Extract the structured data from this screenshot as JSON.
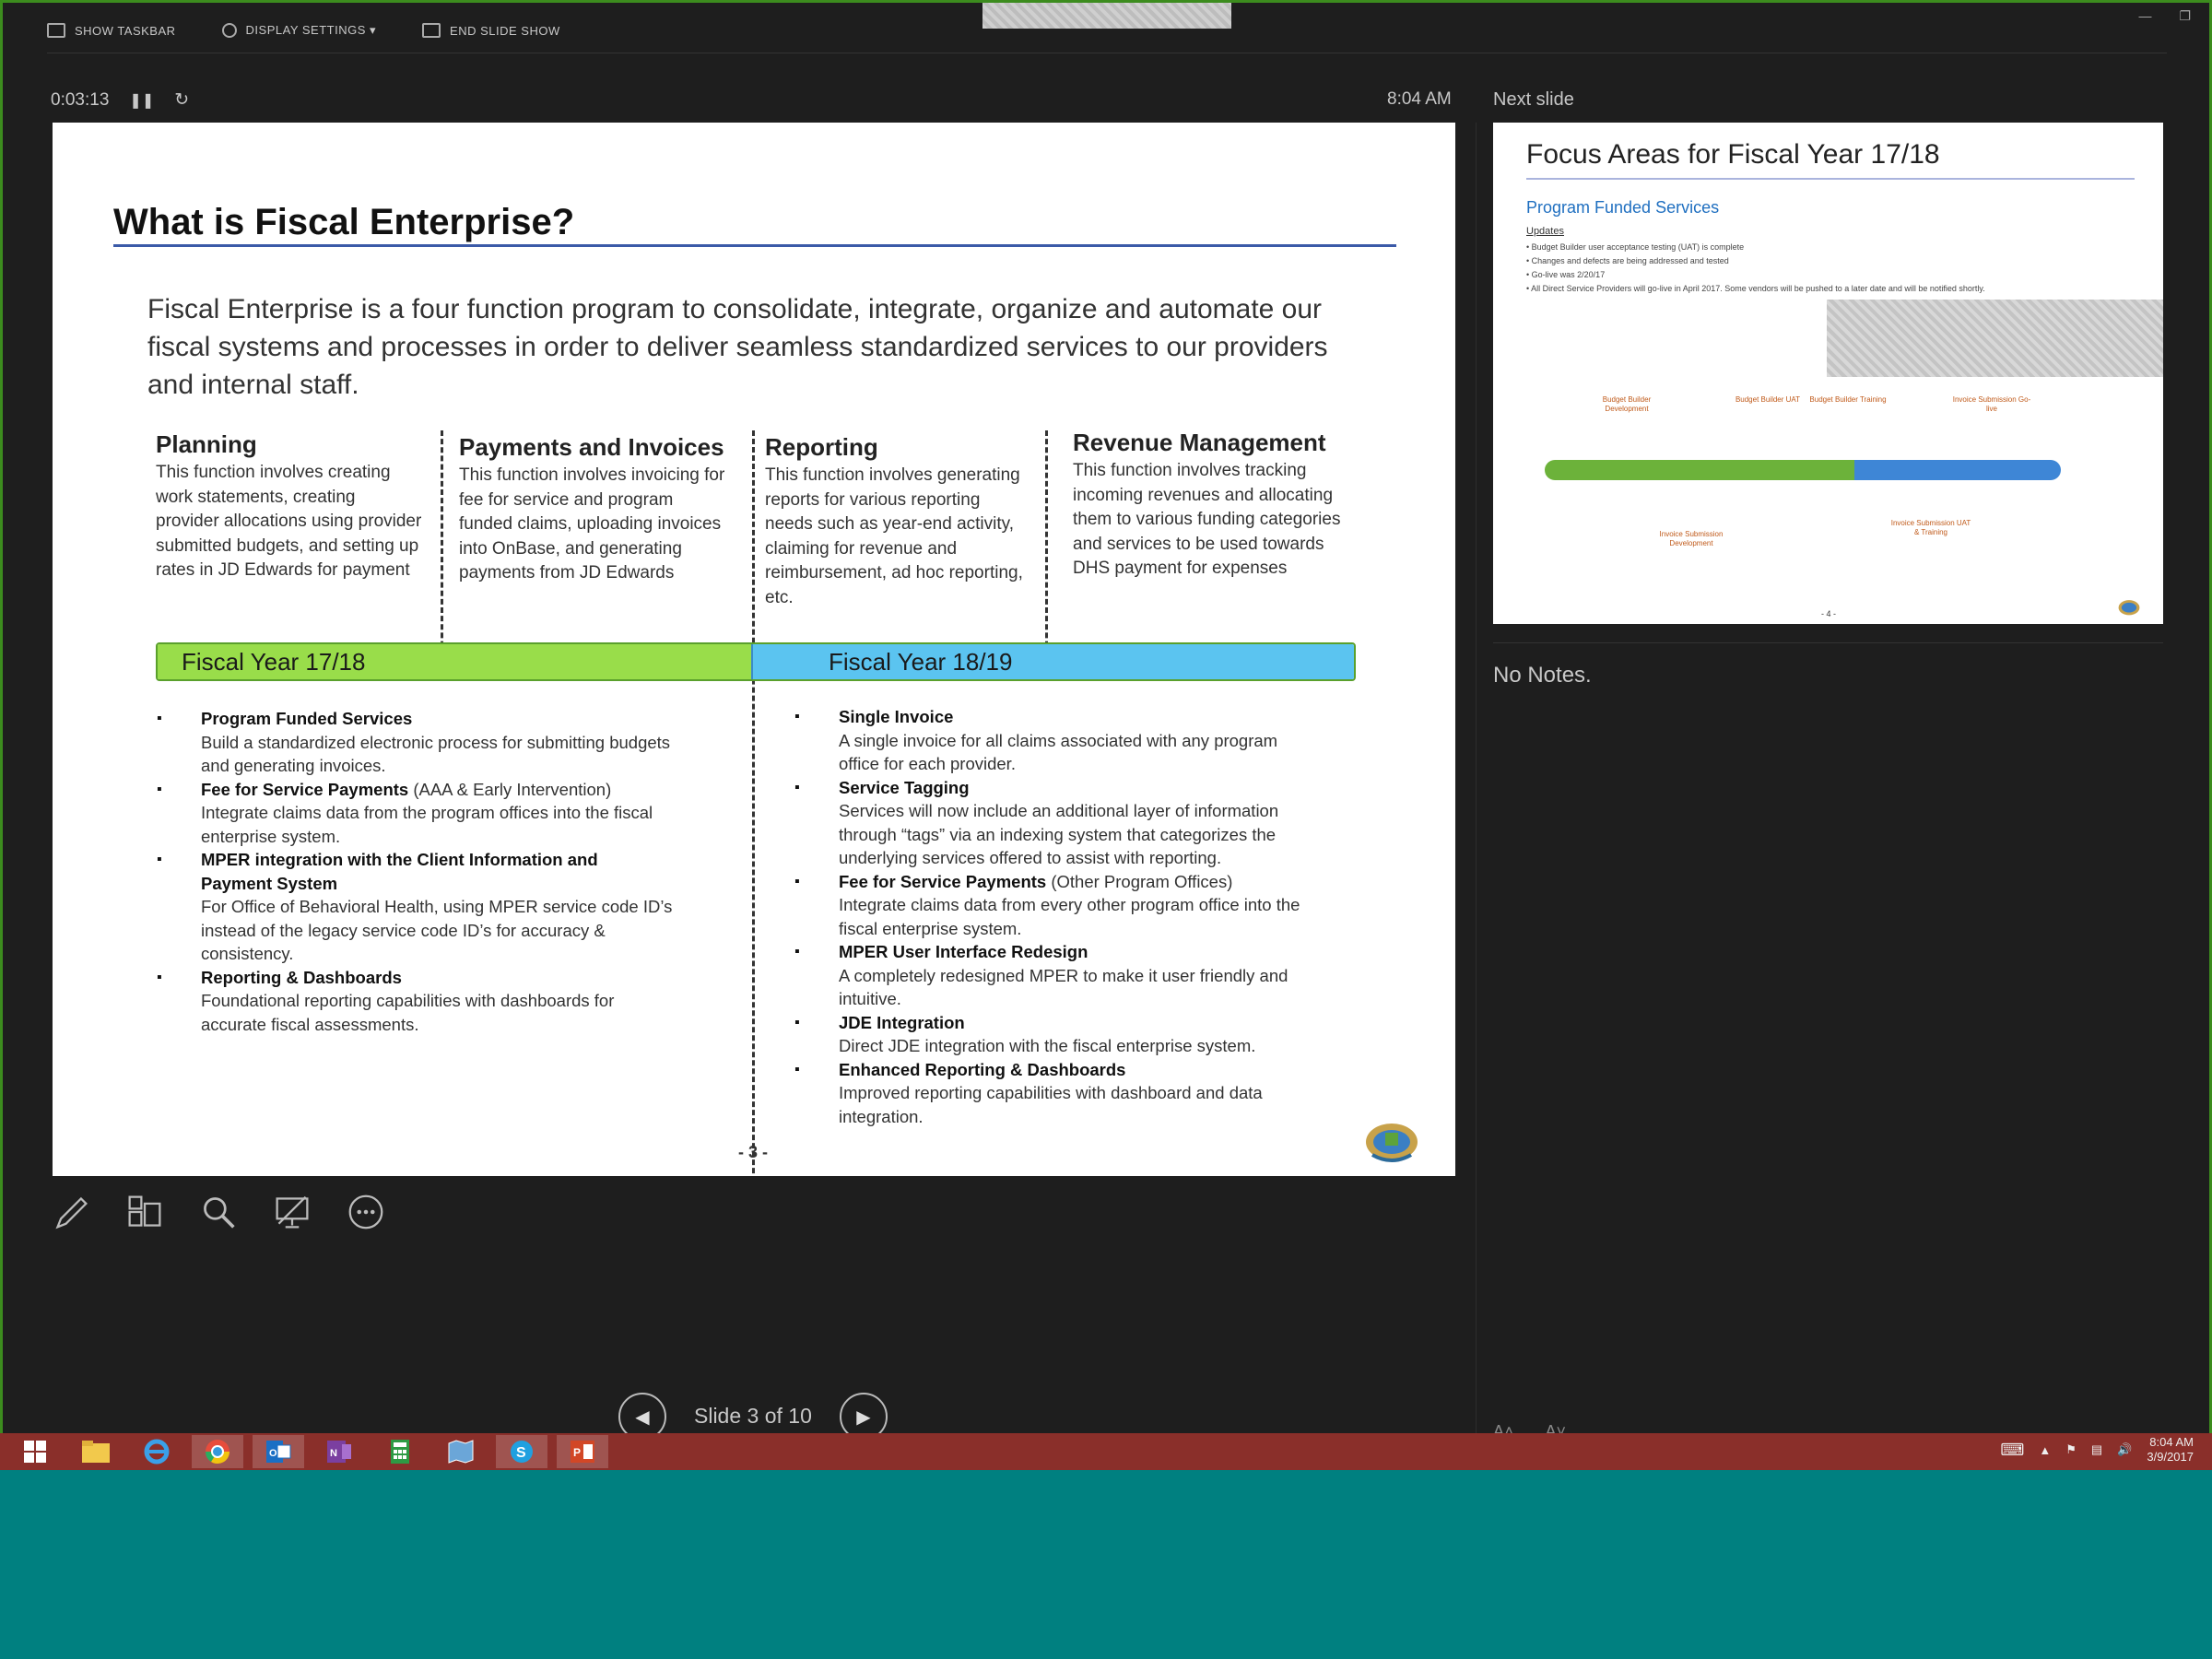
{
  "toolbar": {
    "show_taskbar": "SHOW TASKBAR",
    "display_settings": "DISPLAY SETTINGS ▾",
    "end_slide_show": "END SLIDE SHOW"
  },
  "timer": {
    "elapsed": "0:03:13",
    "pause_icon": "pause-icon",
    "reset_icon": "reset-icon"
  },
  "clock": "8:04 AM",
  "next_slide_label": "Next slide",
  "slide": {
    "title": "What is Fiscal Enterprise?",
    "intro": "Fiscal Enterprise is a four function program to consolidate, integrate, organize and automate our fiscal systems and processes in order to deliver seamless standardized services to our providers and internal staff.",
    "columns": [
      {
        "heading": "Planning",
        "text": "This function involves creating work statements,  creating provider allocations using provider submitted budgets, and setting up rates in JD Edwards for payment"
      },
      {
        "heading": "Payments and Invoices",
        "text": "This function involves invoicing for fee for service and program funded claims, uploading invoices into OnBase, and generating payments from JD Edwards"
      },
      {
        "heading": "Reporting",
        "text": "This function involves generating reports for various reporting needs such as year-end activity, claiming for revenue and reimbursement, ad hoc reporting, etc."
      },
      {
        "heading": "Revenue Management",
        "text": "This function involves tracking incoming revenues and allocating them to various funding categories and services to be used towards DHS payment for expenses"
      }
    ],
    "fy_left": "Fiscal Year 17/18",
    "fy_right": "Fiscal Year 18/19",
    "left_bullets": [
      {
        "title": "Program Funded Services",
        "extra": "",
        "desc": "Build a standardized electronic process for submitting budgets and generating invoices."
      },
      {
        "title": "Fee for Service Payments",
        "extra": " (AAA & Early Intervention)",
        "desc": "Integrate claims data from the program offices into the fiscal enterprise system."
      },
      {
        "title": "MPER integration with the Client Information and Payment System",
        "extra": "",
        "desc": "For Office of Behavioral Health, using MPER service code ID’s instead of the legacy service code ID’s for accuracy & consistency."
      },
      {
        "title": "Reporting & Dashboards",
        "extra": "",
        "desc": "Foundational reporting capabilities with dashboards for accurate fiscal assessments."
      }
    ],
    "right_bullets": [
      {
        "title": "Single Invoice",
        "extra": "",
        "desc": "A single invoice for all claims associated with any program office for each provider."
      },
      {
        "title": "Service Tagging",
        "extra": "",
        "desc": "Services will now include an additional layer of information through “tags” via an indexing system that categorizes the underlying services offered to assist with reporting."
      },
      {
        "title": "Fee for Service Payments",
        "extra": " (Other Program Offices)",
        "desc": "Integrate claims data from every other program office into the fiscal enterprise system."
      },
      {
        "title": "MPER User Interface Redesign",
        "extra": "",
        "desc": "A completely redesigned MPER to make it user friendly and intuitive."
      },
      {
        "title": "JDE Integration",
        "extra": "",
        "desc": "Direct JDE integration with the fiscal enterprise system."
      },
      {
        "title": "Enhanced Reporting & Dashboards",
        "extra": "",
        "desc": "Improved reporting capabilities with dashboard and data integration."
      }
    ],
    "page_number": "- 3 -"
  },
  "tools": [
    "pen-icon",
    "see-all-slides-icon",
    "zoom-icon",
    "black-screen-icon",
    "more-options-icon"
  ],
  "navigation": {
    "status": "Slide 3 of 10"
  },
  "next_slide": {
    "title": "Focus Areas for Fiscal Year 17/18",
    "subtitle": "Program Funded Services",
    "updates_label": "Updates",
    "updates": [
      "Budget Builder user acceptance testing (UAT) is complete",
      "Changes and defects are being addressed and tested",
      "Go-live was 2/20/17",
      "All Direct Service Providers will go-live in April 2017. Some vendors will be pushed to a later date and will be notified shortly."
    ],
    "timeline_labels": [
      "Budget Builder Development",
      "Budget Builder UAT",
      "Budget Builder Training",
      "Invoice Submission Go-live",
      "Invoice Submission Development",
      "Invoice Submission UAT & Training"
    ],
    "page_number": "- 4 -"
  },
  "notes": "No Notes.",
  "tray": {
    "time": "8:04 AM",
    "date": "3/9/2017"
  },
  "colors": {
    "fy_green": "#99dd4a",
    "fy_blue": "#5bc4f0",
    "taskbar": "#8a2f2a",
    "desktop": "#008080"
  }
}
